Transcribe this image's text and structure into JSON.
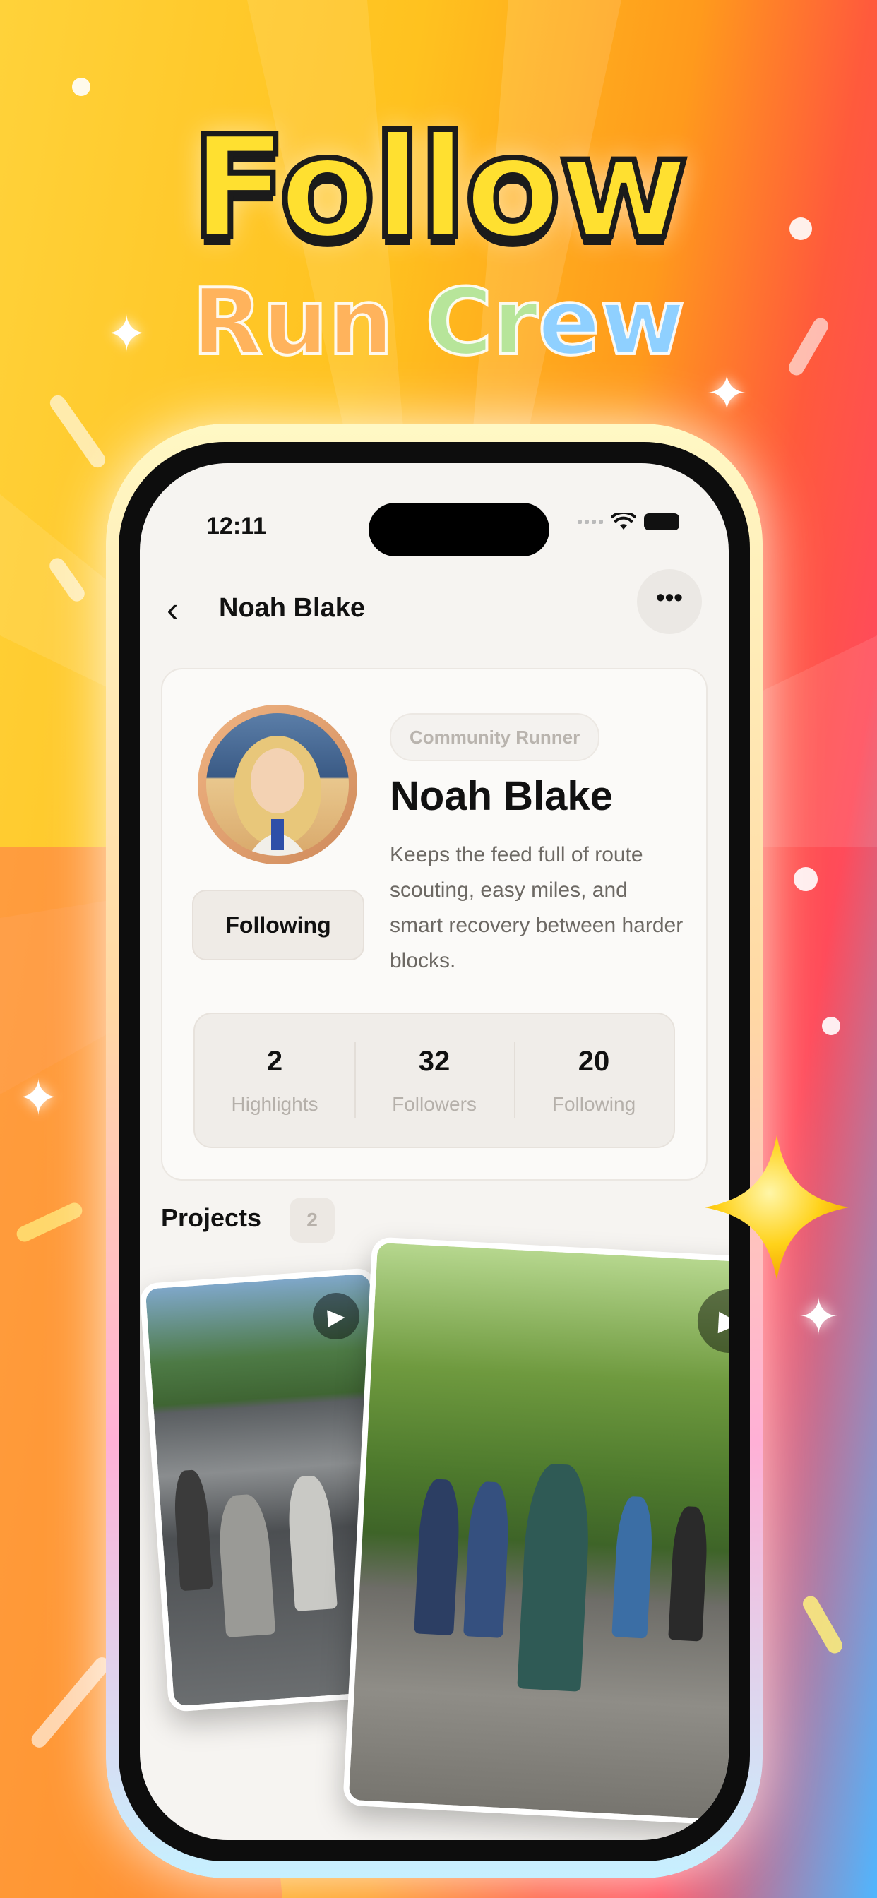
{
  "promo": {
    "title": "Follow",
    "subtitle_part1": "Run",
    "subtitle_part2": "Cr",
    "subtitle_part3": "ew"
  },
  "status_bar": {
    "time": "12:11"
  },
  "nav": {
    "back_icon": "chevron-left",
    "title": "Noah Blake",
    "more_icon": "ellipsis",
    "more_label": "•••"
  },
  "profile": {
    "badge": "Community Runner",
    "name": "Noah Blake",
    "bio": "Keeps the feed full of route scouting, easy miles, and smart recovery between harder blocks.",
    "follow_button": "Following",
    "stats": [
      {
        "value": "2",
        "label": "Highlights"
      },
      {
        "value": "32",
        "label": "Followers"
      },
      {
        "value": "20",
        "label": "Following"
      }
    ]
  },
  "projects": {
    "heading": "Projects",
    "count": "2",
    "play_icon": "▶"
  },
  "colors": {
    "background_yellow": "#ffc21f",
    "background_orange": "#ff9a1c",
    "background_red": "#ff4b5a",
    "background_blue": "#4fb6ff",
    "screen_bg": "#f6f4f1",
    "avatar_ring": "#e0a06f"
  }
}
